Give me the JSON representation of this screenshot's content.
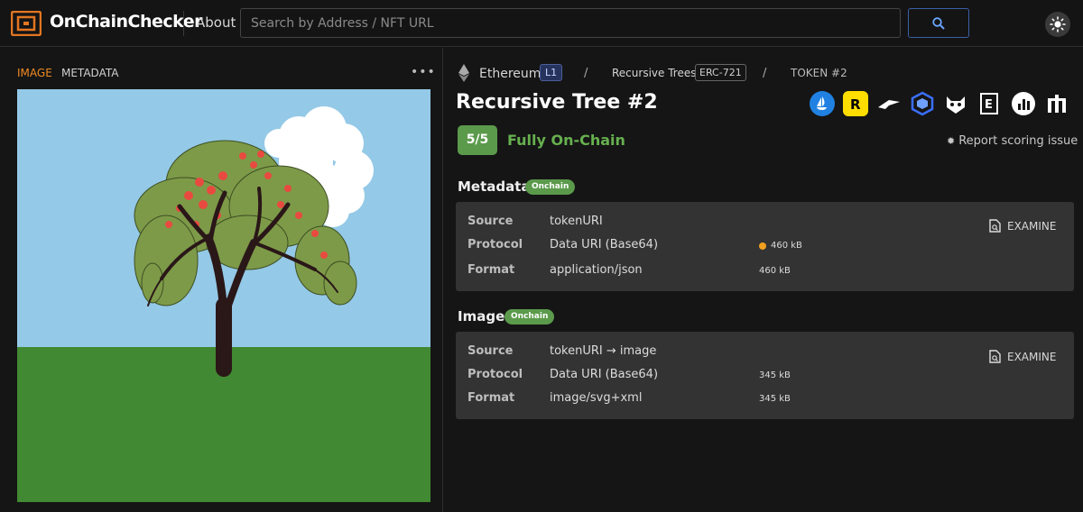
{
  "header": {
    "brand": "OnChainChecker",
    "about_label": "About",
    "search_placeholder": "Search by Address / NFT URL",
    "search_icon": "search-icon",
    "theme_icon": "sun-icon"
  },
  "left_panel": {
    "tabs": [
      {
        "label": "IMAGE",
        "active": true
      },
      {
        "label": "METADATA",
        "active": false
      }
    ],
    "more_label": "•••"
  },
  "breadcrumb": {
    "chain": "Ethereum",
    "chain_badge": "L1",
    "separator": "/",
    "collection": "Recursive Trees",
    "standard_badge": "ERC-721",
    "token": "TOKEN #2"
  },
  "token": {
    "title": "Recursive Tree #2",
    "score": "5/5",
    "score_label": "Fully On-Chain",
    "score_color": "#5b9a4b",
    "report_label": "Report scoring issue"
  },
  "marketplaces": [
    {
      "icon": "opensea-icon",
      "color": "#2081e2"
    },
    {
      "icon": "rarible-icon",
      "color": "#fedd00"
    },
    {
      "icon": "looksrare-icon",
      "color": "#ffffff"
    },
    {
      "icon": "x2y2-icon",
      "color": "#3a6fff"
    },
    {
      "icon": "niftygateway-icon",
      "color": "#ffffff"
    },
    {
      "icon": "etherscan-icon",
      "color": "#ffffff"
    },
    {
      "icon": "chart-icon",
      "color": "#ffffff"
    },
    {
      "icon": "marketplace-icon",
      "color": "#ffffff"
    }
  ],
  "metadata": {
    "title": "Metadata",
    "badge": "Onchain",
    "rows": [
      {
        "label": "Source",
        "value": "tokenURI",
        "size": ""
      },
      {
        "label": "Protocol",
        "value": "Data URI (Base64)",
        "size": "460 kB"
      },
      {
        "label": "Format",
        "value": "application/json",
        "size": "460 kB"
      }
    ],
    "examine_label": "EXAMINE"
  },
  "image": {
    "title": "Image",
    "badge": "Onchain",
    "rows": [
      {
        "label": "Source",
        "value": "tokenURI → image",
        "size": ""
      },
      {
        "label": "Protocol",
        "value": "Data URI (Base64)",
        "size": "345 kB"
      },
      {
        "label": "Format",
        "value": "image/svg+xml",
        "size": "345 kB"
      }
    ],
    "examine_label": "EXAMINE"
  },
  "colors": {
    "accent_orange": "#f08a24",
    "onchain_green": "#5b9a4b",
    "sky": "#94c9e7",
    "grass": "#418932"
  }
}
